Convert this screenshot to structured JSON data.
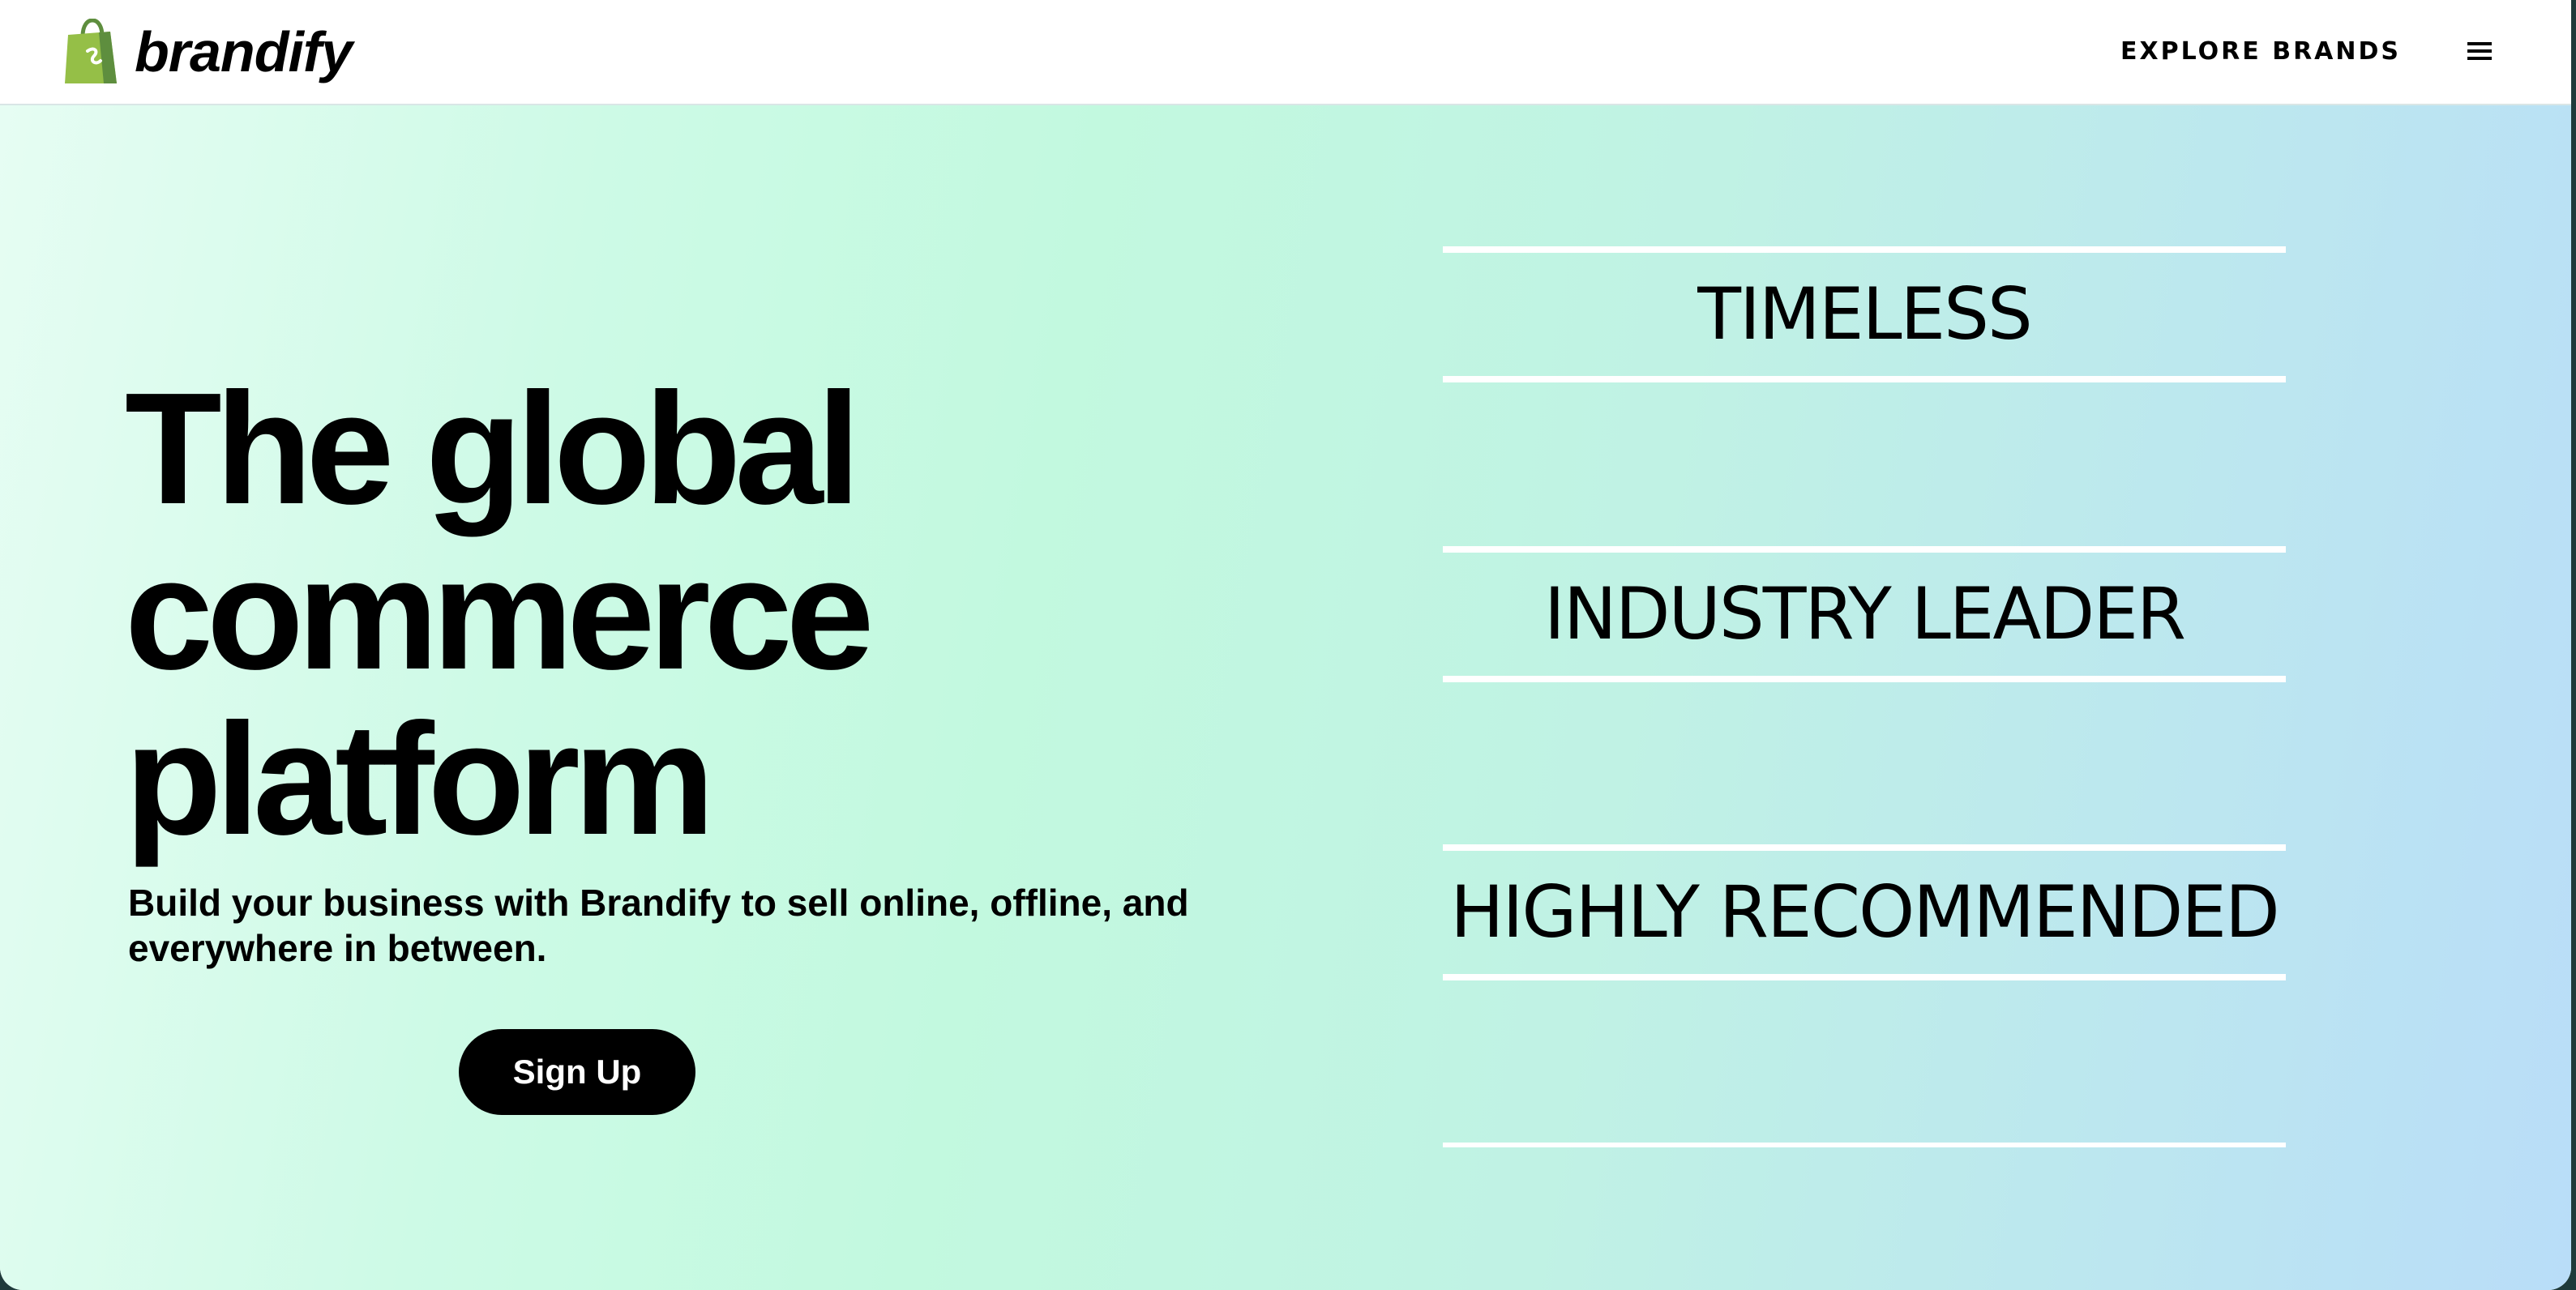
{
  "header": {
    "logo_text": "brandify",
    "explore_link": "EXPLORE BRANDS",
    "menu_icon": "hamburger-menu-icon",
    "logo_icon": "shopping-bag-icon"
  },
  "hero": {
    "headline_line1": "The global",
    "headline_line2": "commerce",
    "headline_line3": "platform",
    "subtext_line1": "Build your business with Brandify to sell online, offline, and",
    "subtext_line2": "everywhere in between.",
    "signup_label": "Sign Up"
  },
  "badges": [
    {
      "label": "TIMELESS"
    },
    {
      "label": "INDUSTRY LEADER"
    },
    {
      "label": "HIGHLY RECOMMENDED"
    }
  ],
  "colors": {
    "brand_green": "#95bf47",
    "button_bg": "#000000",
    "hero_gradient_start": "#e6fdf3",
    "hero_gradient_end": "#b9ddf8"
  }
}
